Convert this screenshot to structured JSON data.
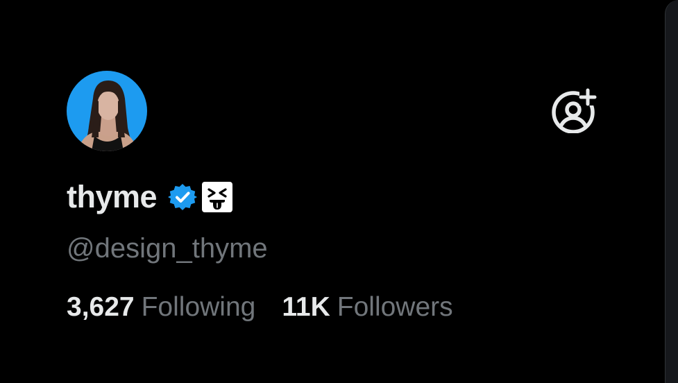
{
  "profile": {
    "display_name": "thyme",
    "handle": "@design_thyme"
  },
  "stats": {
    "following_count": "3,627",
    "following_label": "Following",
    "followers_count": "11K",
    "followers_label": "Followers"
  },
  "icons": {
    "verified": "verified-badge-icon",
    "emoji": "squinting-tongue-emoji-icon",
    "follow": "add-user-icon"
  },
  "colors": {
    "background": "#000000",
    "primary_text": "#e7e9ea",
    "secondary_text": "#71767b",
    "verified_blue": "#1d9bf0",
    "avatar_background": "#1d9bf0"
  }
}
